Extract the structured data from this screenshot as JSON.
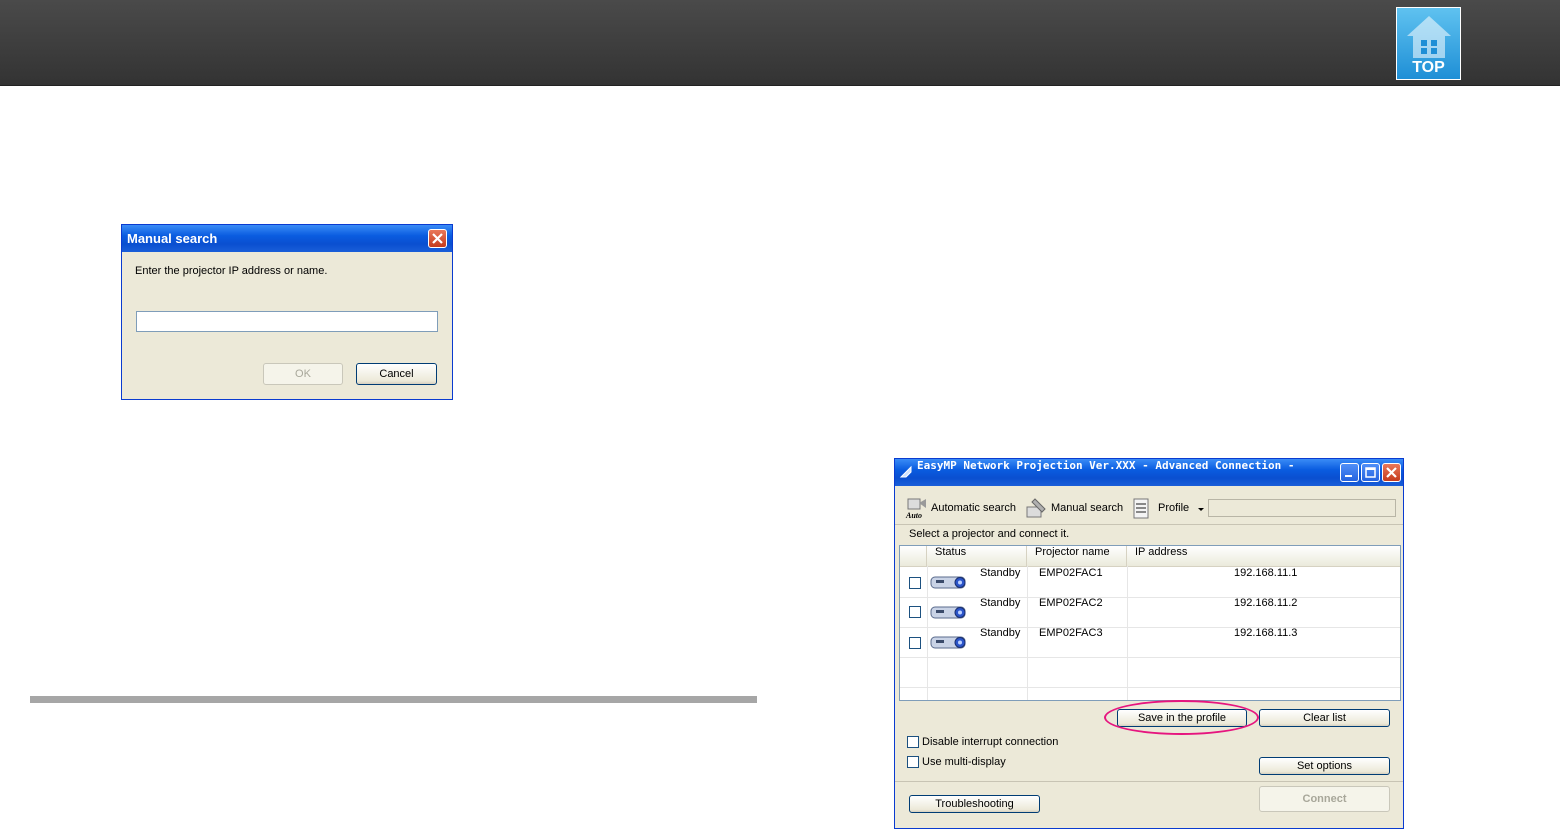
{
  "header": {
    "top_button_label": "TOP"
  },
  "manual_search_dialog": {
    "title": "Manual search",
    "prompt": "Enter the projector IP address or name.",
    "input_value": "",
    "ok_label": "OK",
    "cancel_label": "Cancel"
  },
  "easymp_window": {
    "title": "EasyMP Network Projection Ver.XXX - Advanced Connection -",
    "toolbar": {
      "automatic_search": "Automatic search",
      "auto_icon_text": "Auto",
      "manual_search": "Manual search",
      "profile": "Profile"
    },
    "instruction": "Select a projector and connect it.",
    "columns": [
      "Status",
      "Projector name",
      "IP address"
    ],
    "rows": [
      {
        "status": "Standby",
        "name": "EMP02FAC1",
        "ip": "192.168.11.1"
      },
      {
        "status": "Standby",
        "name": "EMP02FAC2",
        "ip": "192.168.11.2"
      },
      {
        "status": "Standby",
        "name": "EMP02FAC3",
        "ip": "192.168.11.3"
      }
    ],
    "save_profile_label": "Save in the profile",
    "clear_list_label": "Clear list",
    "disable_interrupt_label": "Disable interrupt connection",
    "use_multi_display_label": "Use multi-display",
    "set_options_label": "Set options",
    "troubleshooting_label": "Troubleshooting",
    "connect_label": "Connect"
  },
  "colors": {
    "header_bg": "#3a3a3a",
    "xp_title_blue": "#0a5ce0",
    "xp_close_red": "#c53a1c",
    "highlight_magenta": "#e6157f",
    "top_button_blue": "#1f8fd6"
  }
}
